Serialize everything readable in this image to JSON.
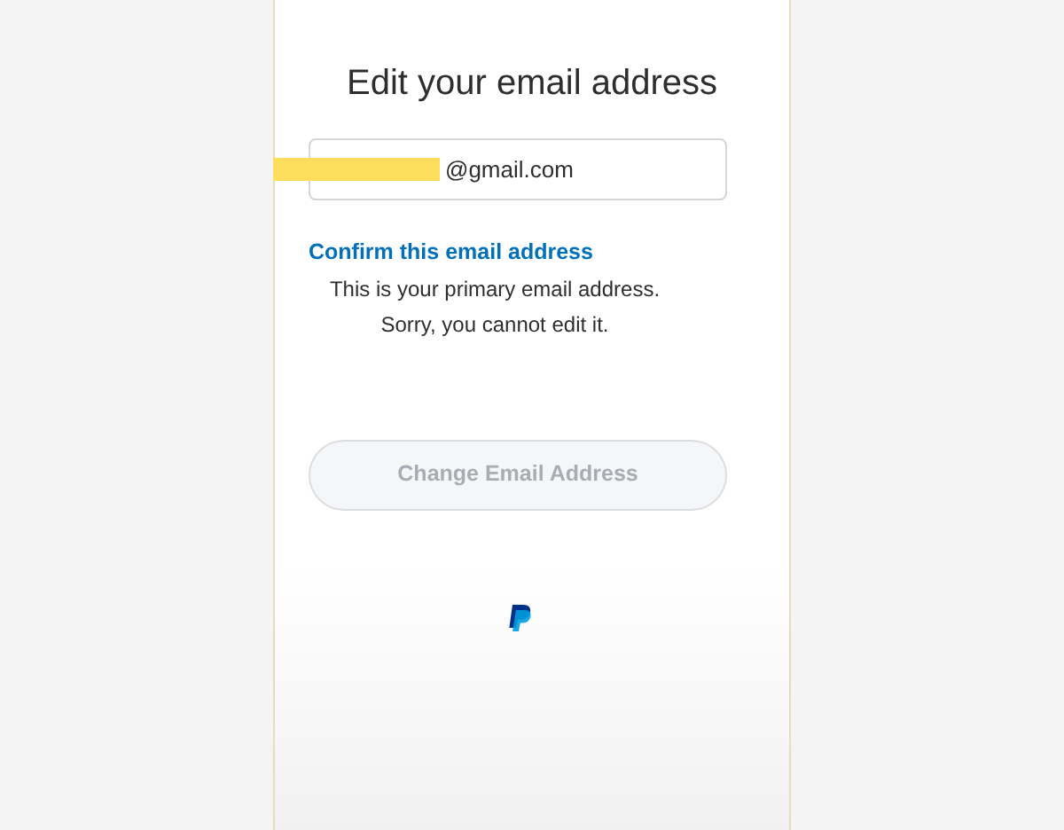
{
  "title": "Edit your email address",
  "email_field": {
    "value": "@gmail.com",
    "redacted": true
  },
  "confirm_link": "Confirm this email address",
  "messages": [
    "This is your primary email address.",
    "Sorry, you cannot edit it."
  ],
  "change_button": {
    "label": "Change Email Address",
    "disabled": true
  }
}
